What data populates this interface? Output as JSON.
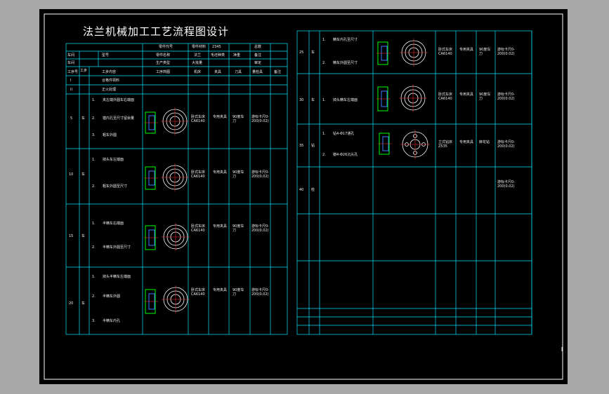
{
  "title": "法兰机械加工工艺流程图设计",
  "header": {
    "part_no_label": "零件代号",
    "part_no_value": "零件材料",
    "part_no_extra": "2345",
    "total_label": "总数",
    "model_label": "型号",
    "part_name_label": "零件名称",
    "part_name_value": "法兰",
    "blank_label": "毛坯种类",
    "mass_label": "净重",
    "parts_label": "备注",
    "workshop_label": "车间",
    "production_label": "生产类型",
    "production_value": "大批量",
    "date_label": "审定"
  },
  "columns": [
    "工序号",
    "工步",
    "工步内容",
    "工序简图",
    "机床",
    "夹具",
    "刀具",
    "量检具",
    "备注"
  ],
  "rows_left": [
    {
      "no": "I",
      "mark": "",
      "content": "合格件领料"
    },
    {
      "no": "II",
      "mark": "",
      "content": "正火处理"
    },
    {
      "no": "5",
      "op": "车",
      "steps": [
        "1.",
        "2.",
        "3."
      ],
      "texts": [
        "夹左端外圆车右端面",
        "镗内孔至尺寸留余量",
        "粗车外圆"
      ],
      "machine": "卧式车床CA6140",
      "fixture": "专用夹具",
      "tool": "90度车刀",
      "gauge": "游标卡尺0-200(0.02)"
    },
    {
      "no": "10",
      "op": "车",
      "steps": [
        "1.",
        "2."
      ],
      "texts": [
        "掉头车左端面",
        "粗车外圆至尺寸"
      ],
      "machine": "卧式车床CA6140",
      "fixture": "专用夹具",
      "tool": "90度车刀",
      "gauge": "游标卡尺0-200(0.02)"
    },
    {
      "no": "15",
      "op": "车",
      "steps": [
        "1.",
        "2."
      ],
      "texts": [
        "半精车右端面",
        "半精车外圆至尺寸"
      ],
      "machine": "卧式车床CA6140",
      "fixture": "专用夹具",
      "tool": "90度车刀",
      "gauge": "游标卡尺0-200(0.02)"
    },
    {
      "no": "20",
      "op": "车",
      "steps": [
        "1.",
        "2.",
        "3."
      ],
      "texts": [
        "掉头半精车左端面",
        "半精车外圆",
        "半精车内孔"
      ],
      "machine": "卧式车床CA6140",
      "fixture": "专用夹具",
      "tool": "90度车刀",
      "gauge": "游标卡尺0-200(0.02)"
    }
  ],
  "rows_right": [
    {
      "no": "25",
      "op": "车",
      "steps": [
        "1.",
        "2."
      ],
      "texts": [
        "精车内孔至尺寸",
        "精车外圆至尺寸"
      ],
      "machine": "卧式车床CA6140",
      "fixture": "专用夹具",
      "tool": "90度车刀",
      "gauge": "游标卡尺0-200(0.02)"
    },
    {
      "no": "30",
      "op": "车",
      "steps": [
        "1."
      ],
      "texts": [
        "掉头精车左端面"
      ],
      "machine": "卧式车床CA6140",
      "fixture": "专用夹具",
      "tool": "90度车刀",
      "gauge": "游标卡尺0-200(0.02)"
    },
    {
      "no": "35",
      "op": "钻",
      "steps": [
        "1.",
        "2."
      ],
      "texts": [
        "钻4-Φ17通孔",
        "锪4-Φ26沉头孔"
      ],
      "machine": "立式钻床Z535",
      "fixture": "专用夹具",
      "tool": "麻花钻",
      "gauge": "游标卡尺0-200(0.02)"
    },
    {
      "no": "40",
      "op": "检",
      "steps": [],
      "texts": [],
      "machine": "",
      "fixture": "",
      "tool": "",
      "gauge": "游标卡尺0-200(0.02)"
    }
  ],
  "colors": {
    "line": "#00e5ff",
    "text": "#ffffff",
    "drawing_green": "#00ff00",
    "drawing_blue": "#3a7dff",
    "drawing_red": "#ff3030",
    "background": "#000000",
    "frame_outer": "#a9a9a9"
  }
}
